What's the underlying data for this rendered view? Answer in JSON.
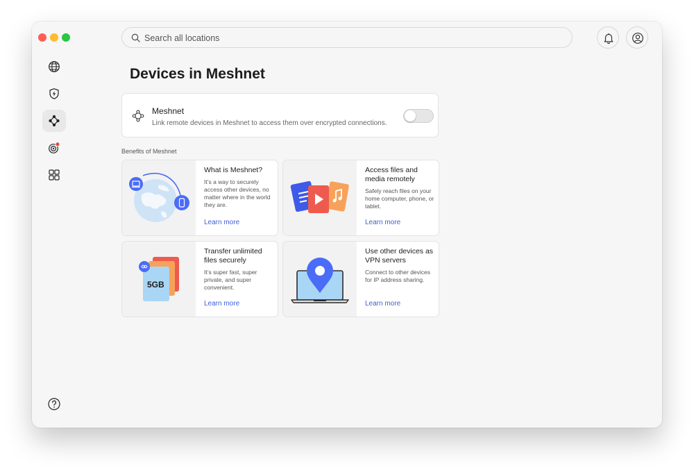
{
  "search": {
    "placeholder": "Search all locations"
  },
  "header": {
    "bell_icon": "bell-icon",
    "profile_icon": "profile-icon"
  },
  "sidebar": {
    "items": [
      {
        "icon": "globe-icon"
      },
      {
        "icon": "shield-bolt-icon"
      },
      {
        "icon": "meshnet-icon",
        "active": true
      },
      {
        "icon": "target-alert-icon"
      },
      {
        "icon": "apps-grid-icon"
      }
    ],
    "help_icon": "help-icon"
  },
  "page": {
    "title": "Devices in Meshnet"
  },
  "meshnet_toggle": {
    "title": "Meshnet",
    "description": "Link remote devices in Meshnet to access them over encrypted connections.",
    "enabled": false
  },
  "benefits": {
    "heading": "Benefits of Meshnet",
    "cards": [
      {
        "title": "What is Meshnet?",
        "description": "It’s a way to securely access other devices, no matter where in the world they are.",
        "link": "Learn more"
      },
      {
        "title": "Access files and media remotely",
        "description": "Safely reach files on your home computer, phone, or tablet.",
        "link": "Learn more"
      },
      {
        "title": "Transfer unlimited files securely",
        "description": "It’s super fast, super private, and super convenient.",
        "link": "Learn more",
        "art_label": "5GB"
      },
      {
        "title": "Use other devices as VPN servers",
        "description": "Connect to other devices for IP address sharing.",
        "link": "Learn more"
      }
    ]
  },
  "colors": {
    "accent_blue": "#4a6cf7",
    "link_blue": "#3e5fd4",
    "window_bg": "#f6f6f6",
    "close": "#ff5f57",
    "minimize": "#febc2e",
    "zoom": "#28c840"
  }
}
